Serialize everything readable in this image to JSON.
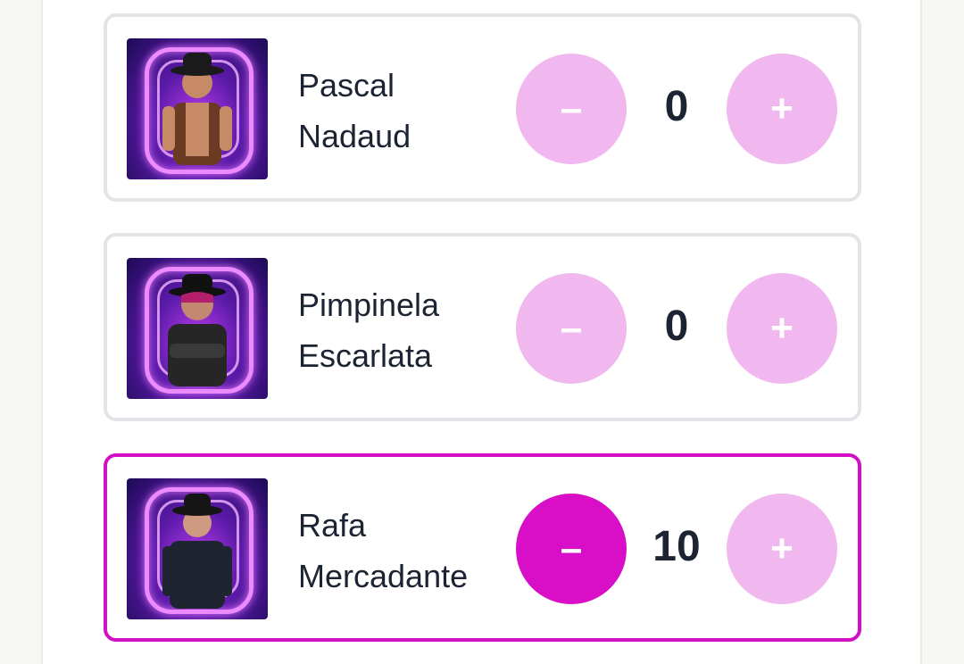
{
  "contestants": [
    {
      "first_name": "Pascal",
      "last_name": "Nadaud",
      "full_name": "Pascal\nNadaud",
      "score": "0",
      "minus_label": "–",
      "plus_label": "+",
      "selected": false,
      "shirt_color": "#6b3a22",
      "skin_color": "#c78a66"
    },
    {
      "first_name": "Pimpinela",
      "last_name": "Escarlata",
      "full_name": "Pimpinela\nEscarlata",
      "score": "0",
      "minus_label": "–",
      "plus_label": "+",
      "selected": false,
      "shirt_color": "#262626",
      "skin_color": "#c28970"
    },
    {
      "first_name": "Rafa",
      "last_name": "Mercadante",
      "full_name": "Rafa\nMercadante",
      "score": "10",
      "minus_label": "–",
      "plus_label": "+",
      "selected": true,
      "shirt_color": "#1e2430",
      "skin_color": "#cf9a82"
    }
  ],
  "colors": {
    "accent": "#d90fc7",
    "button_inactive": "#f1b8f0",
    "card_border": "#e3e4e8",
    "selected_border": "#d10fc4",
    "text": "#1c2433"
  },
  "icons": {
    "minus": "minus-icon",
    "plus": "plus-icon"
  }
}
